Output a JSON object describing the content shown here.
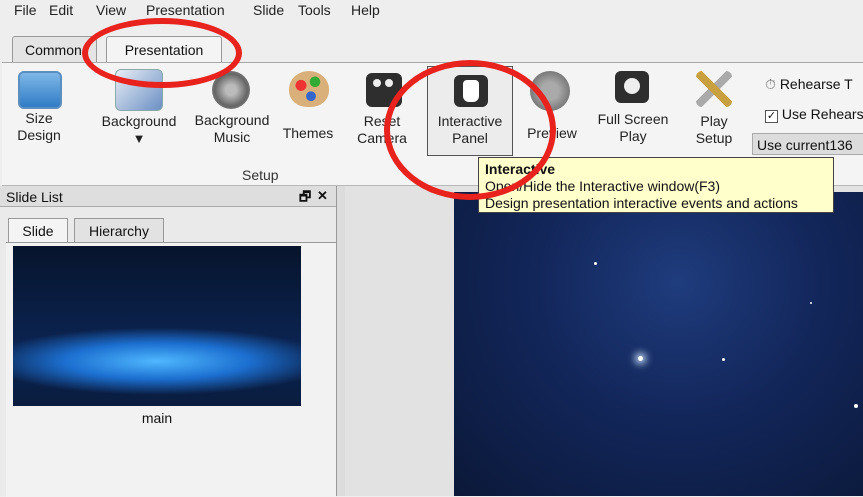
{
  "menu": [
    "File",
    "Edit",
    "View",
    "Presentation",
    "Slide",
    "Tools",
    "Help"
  ],
  "tabs": [
    "Common",
    "Presentation"
  ],
  "ribbon": {
    "size_design": [
      "Size",
      "Design"
    ],
    "background": "Background",
    "background_music": [
      "Background",
      "Music"
    ],
    "themes": "Themes",
    "reset_camera": [
      "Reset",
      "Camera"
    ],
    "interactive_panel": [
      "Interactive",
      "Panel"
    ],
    "preview": "Preview",
    "full_screen_play": [
      "Full Screen",
      "Play"
    ],
    "play_setup": [
      "Play",
      "Setup"
    ],
    "rehearse": "Rehearse T",
    "use_rehearse": "Use Rehears",
    "use_current": "Use current136",
    "group_label": "Setup"
  },
  "tooltip": {
    "title": "Interactive",
    "line1": "Open/Hide the Interactive window(F3)",
    "line2": "Design presentation interactive events and actions"
  },
  "slide_list": {
    "title": "Slide List",
    "float_icon": "🗗",
    "close_icon": "✕",
    "tabs": [
      "Slide",
      "Hierarchy"
    ],
    "thumb_caption": "main"
  },
  "colors": {
    "annotation_ring": "#e8221d",
    "tooltip_bg": "#ffffcc",
    "stage": "#12265a"
  }
}
